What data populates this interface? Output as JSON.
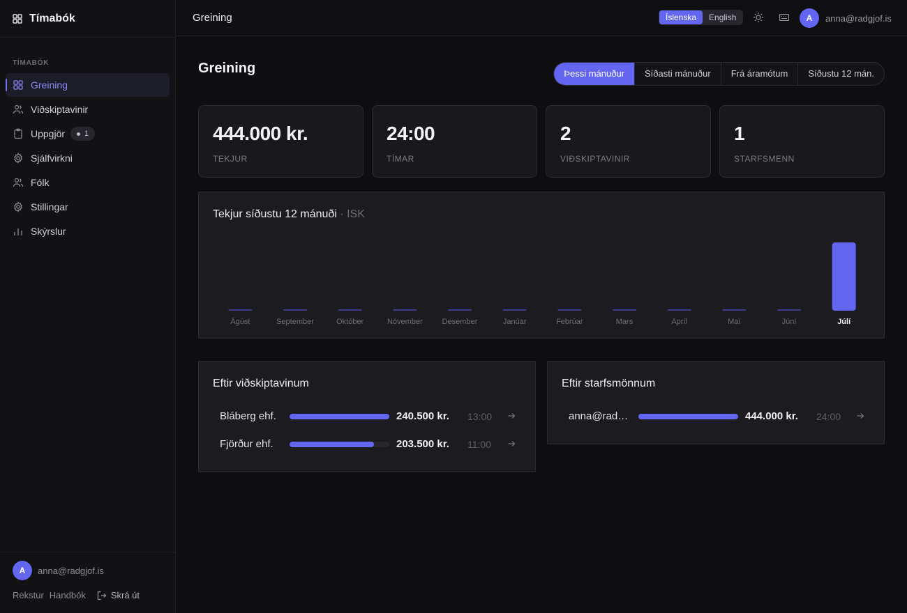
{
  "app": {
    "name": "Tímabók"
  },
  "sidebar": {
    "section": "TÍMABÓK",
    "items": [
      {
        "label": "Greining",
        "icon": "grid-icon",
        "active": true
      },
      {
        "label": "Viðskiptavinir",
        "icon": "users-icon"
      },
      {
        "label": "Uppgjör",
        "icon": "clipboard-icon",
        "badge": "1"
      },
      {
        "label": "Sjálfvirkni",
        "icon": "gear-icon"
      },
      {
        "label": "Fólk",
        "icon": "users-icon"
      },
      {
        "label": "Stillingar",
        "icon": "gear-icon"
      },
      {
        "label": "Skýrslur",
        "icon": "bar-chart-icon"
      }
    ],
    "footer": {
      "avatar": "A",
      "email": "anna@radgjof.is",
      "links": [
        "Rekstur",
        "Handbók"
      ],
      "logout": "Skrá út"
    }
  },
  "topbar": {
    "title": "Greining",
    "languages": [
      "Íslenska",
      "English"
    ],
    "active_language": "Íslenska",
    "avatar": "A",
    "email": "anna@radgjof.is"
  },
  "main": {
    "title": "Greining",
    "ranges": [
      "Þessi mánuður",
      "Síðasti mánuður",
      "Frá áramótum",
      "Síðustu 12 mán."
    ],
    "active_range": "Þessi mánuður",
    "kpis": [
      {
        "value": "444.000 kr.",
        "label": "TEKJUR"
      },
      {
        "value": "24:00",
        "label": "TÍMAR"
      },
      {
        "value": "2",
        "label": "VIÐSKIPTAVINIR"
      },
      {
        "value": "1",
        "label": "STARFSMENN"
      }
    ],
    "by_client": {
      "title": "Eftir viðskiptavinum",
      "rows": [
        {
          "name": "Bláberg ehf.",
          "amount": "240.500 kr.",
          "hours": "13:00",
          "share": 1.0
        },
        {
          "name": "Fjörður ehf.",
          "amount": "203.500 kr.",
          "hours": "11:00",
          "share": 0.846
        }
      ]
    },
    "by_employee": {
      "title": "Eftir starfsmönnum",
      "rows": [
        {
          "name": "anna@radg…",
          "amount": "444.000 kr.",
          "hours": "24:00",
          "share": 1.0
        }
      ]
    }
  },
  "colors": {
    "accent": "#6366f1",
    "background": "#0e0e11",
    "card": "#1b1b20"
  },
  "chart_data": {
    "type": "bar",
    "title": "Tekjur síðustu 12 mánuði",
    "unit": "ISK",
    "categories": [
      "Ágúst",
      "September",
      "Október",
      "Nóvember",
      "Desember",
      "Janúar",
      "Febrúar",
      "Mars",
      "Apríl",
      "Maí",
      "Júní",
      "Júlí"
    ],
    "values": [
      0,
      0,
      0,
      0,
      0,
      0,
      0,
      0,
      0,
      0,
      0,
      444000
    ],
    "highlight": "Júlí",
    "ylim": [
      0,
      444000
    ],
    "grid": false,
    "legend": false
  }
}
